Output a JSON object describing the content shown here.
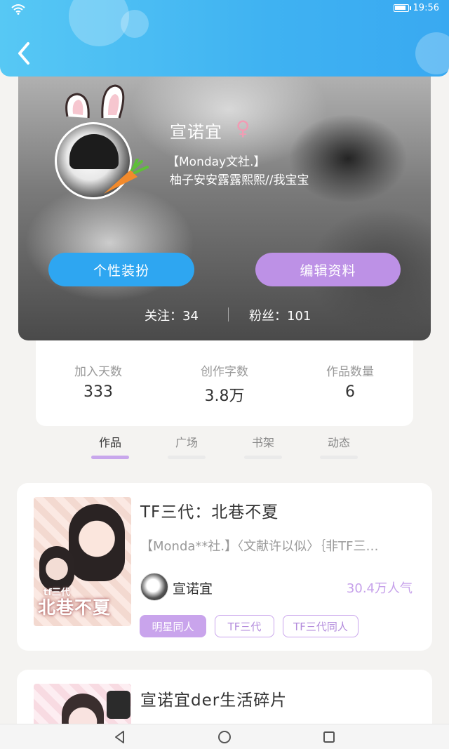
{
  "status_bar": {
    "time": "19:56",
    "wifi_icon": "wifi-icon",
    "battery_icon": "battery-icon"
  },
  "header": {
    "back_icon": "chevron-left-icon"
  },
  "profile": {
    "name": "宣诺宜",
    "gender_symbol": "♀",
    "motto_line1": "【Monday文社.】",
    "motto_line2": "柚子安安露露熙熙//我宝宝",
    "dress_button": "个性装扮",
    "edit_button": "编辑资料",
    "following": "关注：34",
    "followers": "粉丝：101"
  },
  "stats": [
    {
      "label": "加入天数",
      "value": "333"
    },
    {
      "label": "创作字数",
      "value": "3.8万"
    },
    {
      "label": "作品数量",
      "value": "6"
    }
  ],
  "tabs": [
    {
      "label": "作品",
      "active": true
    },
    {
      "label": "广场",
      "active": false
    },
    {
      "label": "书架",
      "active": false
    },
    {
      "label": "动态",
      "active": false
    }
  ],
  "works": [
    {
      "title": "TF三代：北巷不夏",
      "description": "【Monda**社.】〈文献许以似〉｛非TF三…",
      "cover_text": "北巷不夏",
      "cover_subtext": "tf三代",
      "author": "宣诺宜",
      "popularity": "30.4万人气",
      "tags": [
        "明星同人",
        "TF三代",
        "TF三代同人"
      ]
    },
    {
      "title": "宣诺宜der生活碎片"
    }
  ],
  "nav": {
    "back": "triangle-back-icon",
    "home": "circle-home-icon",
    "recent": "square-recent-icon"
  },
  "colors": {
    "header_blue": "#3fb2f2",
    "accent_purple": "#c9a4ec",
    "button_blue": "#2ea6f1",
    "female_pink": "#f19cb4"
  }
}
